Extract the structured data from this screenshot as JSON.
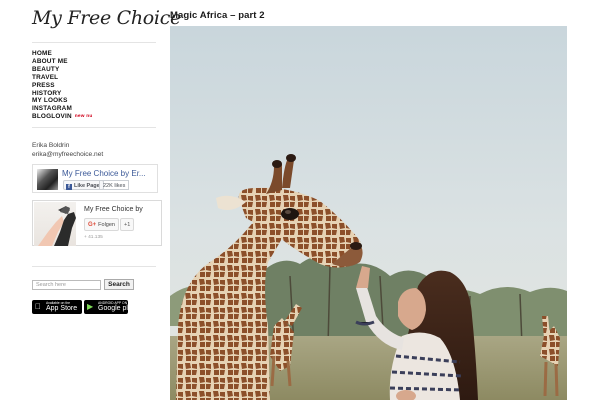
{
  "site": {
    "logo": "My Free Choice"
  },
  "nav": {
    "items": [
      "HOME",
      "ABOUT ME",
      "BEAUTY",
      "TRAVEL",
      "PRESS",
      "HISTORY",
      "MY LOOKS",
      "INSTAGRAM",
      "BLOGLOVIN"
    ],
    "new_badge": "new nu"
  },
  "author": {
    "name": "Erika Boldrin",
    "email": "erika@myfreechoice.net"
  },
  "facebook": {
    "page_name": "My Free Choice by Er...",
    "like_label": "Like Page",
    "like_count": "22K likes"
  },
  "google_plus": {
    "page_name": "My Free Choice by",
    "follow_label": "Folgen",
    "plus_one_label": "+1",
    "follower_count": "+ 41.135"
  },
  "search": {
    "placeholder": "Search here",
    "button_label": "Search"
  },
  "app_badges": {
    "app_store_small": "Available on the",
    "app_store_big": "App Store",
    "google_play_small": "ANDROID APP ON",
    "google_play_big": "Google play"
  },
  "post": {
    "title": "Magic Africa – part 2"
  },
  "icons": [
    "apple-icon",
    "google-play-icon",
    "facebook-icon",
    "google-plus-icon"
  ],
  "colors": {
    "accent_new": "#d0021b",
    "facebook_blue": "#3b5998",
    "google_red": "#dd4b39"
  }
}
